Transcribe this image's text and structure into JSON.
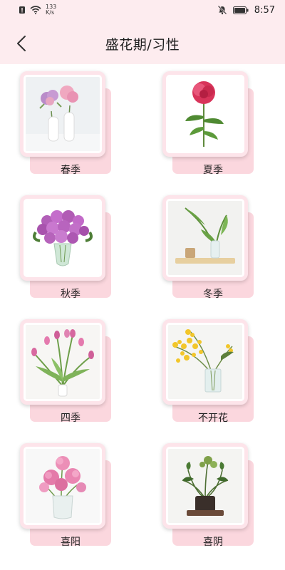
{
  "status_bar": {
    "speed_value": "133",
    "speed_unit": "K/s",
    "time": "8:57"
  },
  "header": {
    "title": "盛花期/习性"
  },
  "cards": [
    {
      "label": "春季",
      "image": "two white vases with pink hydrangeas"
    },
    {
      "label": "夏季",
      "image": "single red peony"
    },
    {
      "label": "秋季",
      "image": "bouquet of purple roses in glass vase"
    },
    {
      "label": "冬季",
      "image": "green leaves in glass vase on wooden tray"
    },
    {
      "label": "四季",
      "image": "pink tulips bouquet"
    },
    {
      "label": "不开花",
      "image": "yellow mimosa in glass vase"
    },
    {
      "label": "喜阳",
      "image": "pink peonies in glass vase"
    },
    {
      "label": "喜阴",
      "image": "green plant in dark pot"
    }
  ],
  "colors": {
    "header_bg": "#fdecef",
    "card_back_tile": "#fbd7de",
    "card_frame": "#fde4ea"
  }
}
